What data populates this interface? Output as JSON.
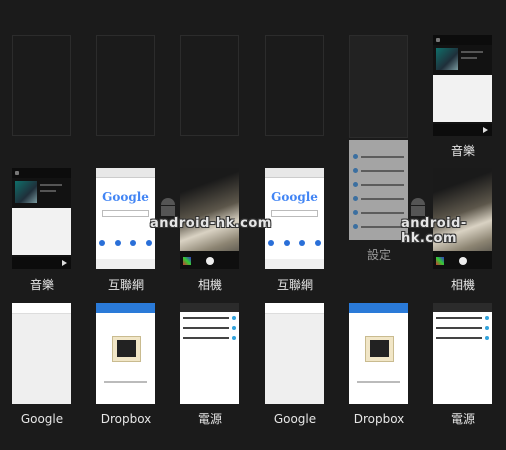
{
  "rows": [
    {
      "cards": [
        {
          "label": "",
          "thumb": "empty"
        },
        {
          "label": "",
          "thumb": "empty"
        },
        {
          "label": "",
          "thumb": "empty"
        },
        {
          "label": "",
          "thumb": "empty"
        },
        {
          "label": "",
          "thumb": "empty"
        },
        {
          "label": "音樂",
          "thumb": "music"
        }
      ]
    },
    {
      "cards": [
        {
          "label": "音樂",
          "thumb": "music"
        },
        {
          "label": "互聯網",
          "thumb": "browser"
        },
        {
          "label": "相機",
          "thumb": "camera"
        },
        {
          "label": "互聯網",
          "thumb": "browser"
        },
        {
          "label": "設定",
          "thumb": "settings"
        },
        {
          "label": "相機",
          "thumb": "camera"
        }
      ]
    },
    {
      "cards": [
        {
          "label": "Google",
          "thumb": "google"
        },
        {
          "label": "Dropbox",
          "thumb": "dropbox"
        },
        {
          "label": "電源",
          "thumb": "power"
        },
        {
          "label": "Google",
          "thumb": "google"
        },
        {
          "label": "Dropbox",
          "thumb": "dropbox"
        },
        {
          "label": "電源",
          "thumb": "power"
        }
      ]
    }
  ],
  "browser_logo": "Google",
  "watermark": "android-hk.com",
  "icons": {
    "music_play": "play-icon",
    "camera_shutter": "shutter-icon",
    "mascot": "android-mascot-icon"
  },
  "colors": {
    "background": "#1b1b1b",
    "accent": "#2a7ad8",
    "google_blue": "#4285f4"
  }
}
